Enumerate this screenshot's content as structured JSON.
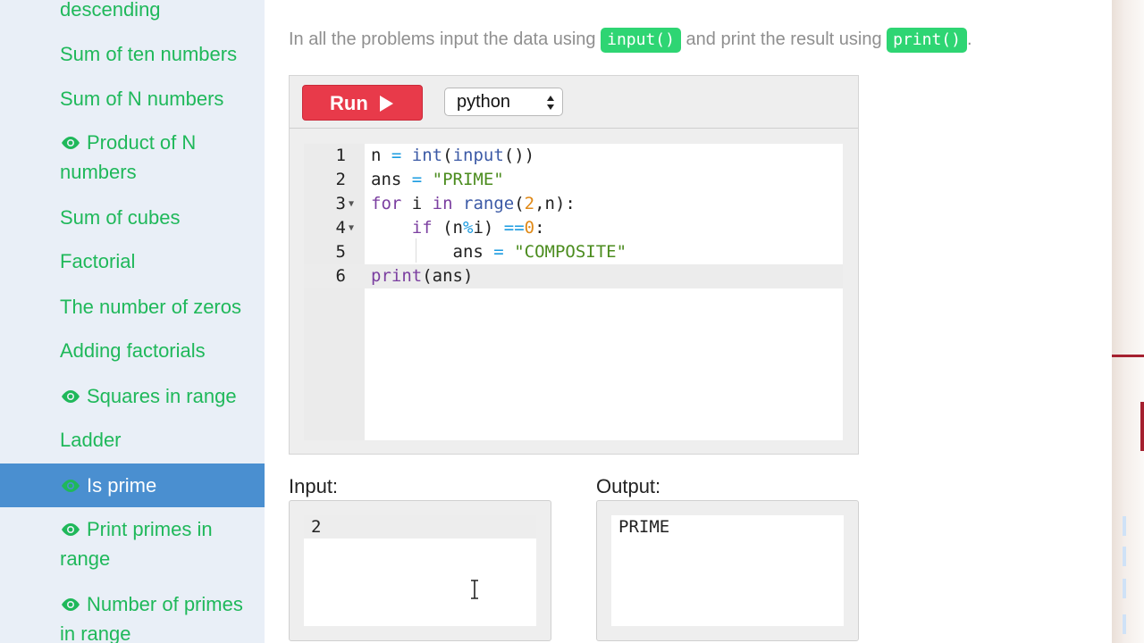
{
  "sidebar": {
    "items": [
      {
        "label": "descending",
        "eye": false
      },
      {
        "label": "Sum of ten numbers",
        "eye": false
      },
      {
        "label": "Sum of N numbers",
        "eye": false
      },
      {
        "label": "Product of N numbers",
        "eye": true
      },
      {
        "label": "Sum of cubes",
        "eye": false
      },
      {
        "label": "Factorial",
        "eye": false
      },
      {
        "label": "The number of zeros",
        "eye": false
      },
      {
        "label": "Adding factorials",
        "eye": false
      },
      {
        "label": "Squares in range",
        "eye": true
      },
      {
        "label": "Ladder",
        "eye": false
      },
      {
        "label": "Is prime",
        "eye": true,
        "active": true
      },
      {
        "label": "Print primes in range",
        "eye": true
      },
      {
        "label": "Number of primes in range",
        "eye": true
      }
    ]
  },
  "intro": {
    "text_before": "In all the problems input the data using ",
    "chip_input": "input()",
    "text_middle": " and print the result using ",
    "chip_print": "print()",
    "text_after": "."
  },
  "toolbar": {
    "run_label": "Run",
    "language": "python"
  },
  "code": {
    "current_line": 6,
    "lines": [
      {
        "number": "1",
        "text": "n = int(input())"
      },
      {
        "number": "2",
        "text": "ans = \"PRIME\""
      },
      {
        "number": "3",
        "text": "for i in range(2,n):"
      },
      {
        "number": "4",
        "text": "    if (n%i) ==0:"
      },
      {
        "number": "5",
        "text": "        ans = \"COMPOSITE\""
      },
      {
        "number": "6",
        "text": "print(ans)"
      }
    ]
  },
  "io": {
    "input_label": "Input:",
    "input_value": "2",
    "output_label": "Output:",
    "output_value": "PRIME"
  },
  "colors": {
    "accent_green": "#1fb85a",
    "chip_green": "#2ed573",
    "active_blue": "#4a8fd0",
    "run_red": "#e83a4a"
  }
}
